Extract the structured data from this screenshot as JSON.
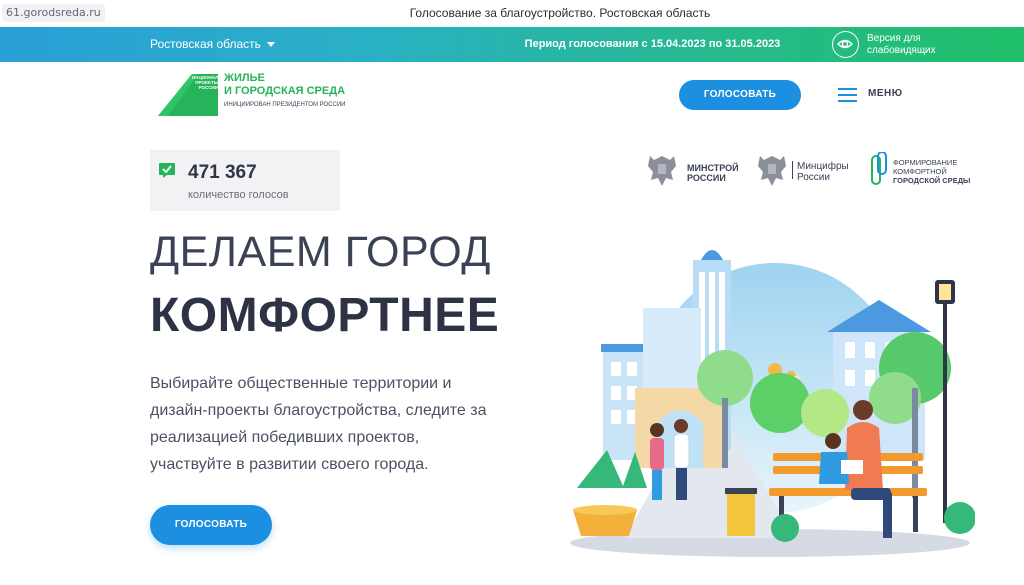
{
  "browser": {
    "url": "61.gorodsreda.ru",
    "tab_title": "Голосование за благоустройство. Ростовская область"
  },
  "top_strip": {
    "region": "Ростовская область",
    "period": "Период голосования с 15.04.2023 по 31.05.2023",
    "accessibility_label_line1": "Версия для",
    "accessibility_label_line2": "слабовидящих"
  },
  "header": {
    "logo_badge_line1": "НАЦИОНАЛЬНЫЕ",
    "logo_badge_line2": "ПРОЕКТЫ",
    "logo_badge_line3": "РОССИИ",
    "logo_title_line1": "ЖИЛЬЕ",
    "logo_title_line2": "И ГОРОДСКАЯ СРЕДА",
    "logo_subtitle": "ИНИЦИИРОВАН ПРЕЗИДЕНТОМ РОССИИ",
    "vote_button": "ГОЛОСОВАТЬ",
    "menu_label": "МЕНЮ"
  },
  "counter": {
    "value": "471 367",
    "label": "количество голосов"
  },
  "partners": {
    "minstroy_line1": "МИНСТРОЙ",
    "minstroy_line2": "РОССИИ",
    "mintsifry_line1": "Минцифры",
    "mintsifry_line2": "России",
    "fks_line1": "ФОРМИРОВАНИЕ",
    "fks_line2": "КОМФОРТНОЙ",
    "fks_line3": "ГОРОДСКОЙ СРЕДЫ"
  },
  "hero": {
    "title_line1": "ДЕЛАЕМ ГОРОД",
    "title_line2": "КОМФОРТНЕЕ",
    "desc_line1": "Выбирайте общественные территории и",
    "desc_line2": "дизайн-проекты благоустройства, следите за",
    "desc_line3": "реализацией победивших проектов,",
    "desc_line4": "участвуйте в развитии своего города.",
    "vote_button": "ГОЛОСОВАТЬ"
  },
  "colors": {
    "accent_blue": "#1d8fe0",
    "brand_green": "#27b35a",
    "strip_start": "#2a9fd8",
    "strip_end": "#20c06a",
    "text_dark": "#2d3344"
  },
  "icons": {
    "region_dropdown": "chevron-down-icon",
    "accessibility": "eye-icon",
    "menu": "hamburger-icon",
    "counter": "check-icon"
  }
}
